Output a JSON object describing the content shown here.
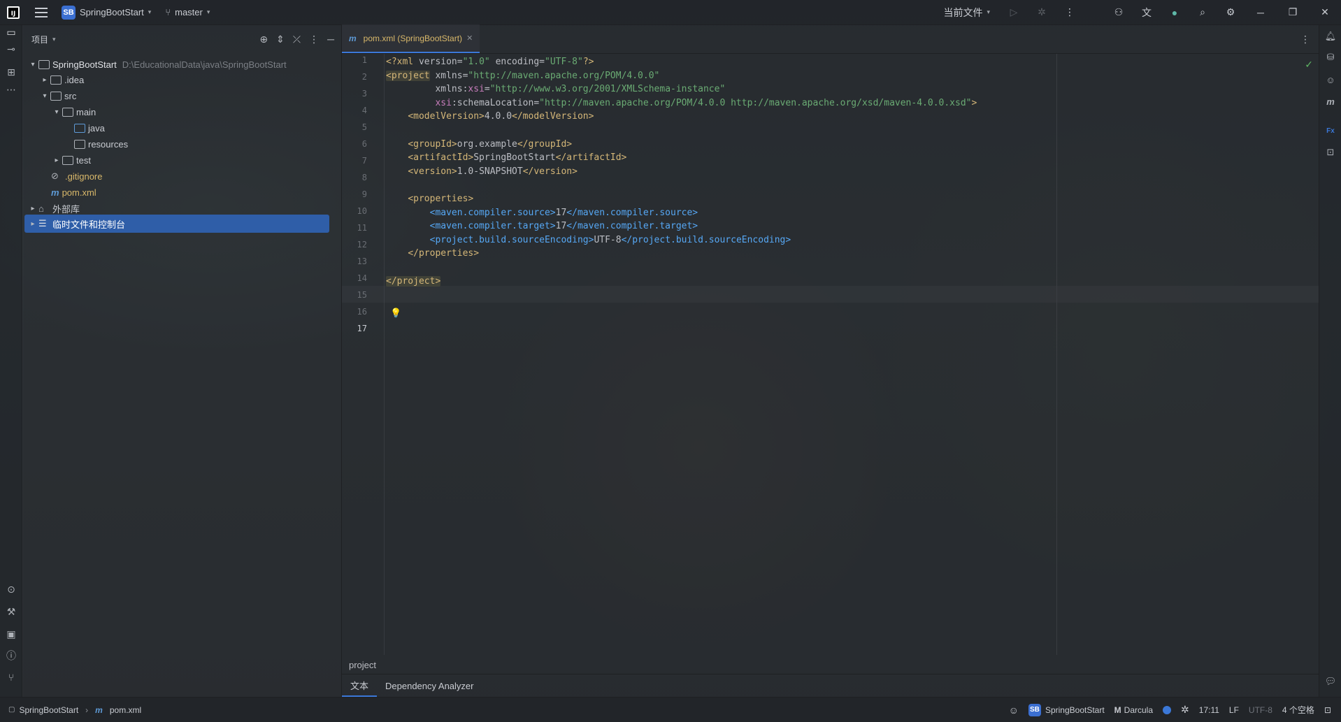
{
  "titlebar": {
    "project_badge": "SB",
    "project_name": "SpringBootStart",
    "branch": "master",
    "run_config": "当前文件",
    "logo_letters": "IJ"
  },
  "project_panel": {
    "title": "项目",
    "tree": [
      {
        "label": "SpringBootStart",
        "path": "D:\\EducationalData\\java\\SpringBootStart",
        "level": 0,
        "expanded": true
      },
      {
        "label": ".idea",
        "level": 1,
        "expanded": false
      },
      {
        "label": "src",
        "level": 1,
        "expanded": true
      },
      {
        "label": "main",
        "level": 2,
        "expanded": true
      },
      {
        "label": "java",
        "level": 3
      },
      {
        "label": "resources",
        "level": 3
      },
      {
        "label": "test",
        "level": 2,
        "expanded": false
      },
      {
        "label": ".gitignore",
        "level": 1
      },
      {
        "label": "pom.xml",
        "level": 1
      },
      {
        "label": "外部库",
        "level": 0,
        "expanded": false
      },
      {
        "label": "临时文件和控制台",
        "level": 0,
        "expanded": false,
        "selected": true
      }
    ]
  },
  "editor": {
    "tab_label": "pom.xml (SpringBootStart)",
    "line_numbers": [
      "1",
      "2",
      "3",
      "4",
      "5",
      "6",
      "7",
      "8",
      "9",
      "10",
      "11",
      "12",
      "13",
      "14",
      "15",
      "16",
      "17"
    ],
    "current_line": "17",
    "breadcrumb": "project",
    "bottom_tabs": [
      "文本",
      "Dependency Analyzer"
    ]
  },
  "statusbar": {
    "crumb_project": "SpringBootStart",
    "crumb_file": "pom.xml",
    "project_badge": "SB",
    "project_name": "SpringBootStart",
    "theme": "Darcula",
    "position": "17:11",
    "line_sep": "LF",
    "encoding": "UTF-8",
    "indent": "4 个空格"
  },
  "colors": {
    "accent": "#3b78d8",
    "selection": "#2f5ea8",
    "tag": "#d5b778",
    "string": "#6aab73",
    "property_tag": "#56a8f5"
  }
}
